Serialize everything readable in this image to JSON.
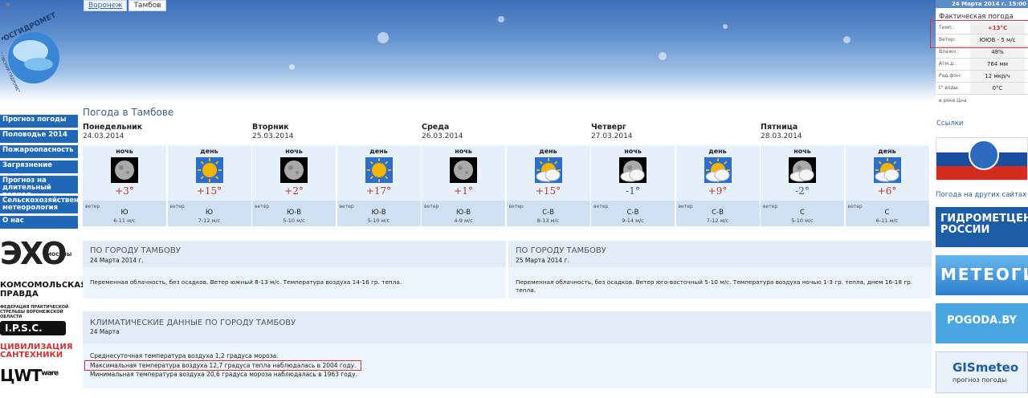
{
  "header": {
    "tabs": [
      {
        "label": "Воронеж"
      },
      {
        "label": "Тамбов"
      }
    ],
    "logo_text": "РОСГИДРОМЕТ",
    "logo_subtext": "ТАМБОВСКИЙ ГИДРОМЕТЦЕНТР",
    "datestamp": "24 Марта 2014 г. 15:00"
  },
  "nav": {
    "items": [
      {
        "label": "Прогноз погоды"
      },
      {
        "label": "Половодье 2014"
      },
      {
        "label": "Пожароопасность"
      },
      {
        "label": "Загрязнение"
      },
      {
        "label": "Прогноз на длительный период"
      },
      {
        "label": "Сельскохозяйственная метеорология"
      },
      {
        "label": "О нас"
      }
    ]
  },
  "left_logos": {
    "echo": "ЭХО",
    "echo_sub": "МОСКВЫ",
    "kp": "КОМСОМОЛЬСКАЯ ПРАВДА",
    "ipsc_caption": "ФЕДЕРАЦИЯ ПРАКТИЧЕСКОЙ СТРЕЛЬБЫ ВОРОНЕЖСКОЙ ОБЛАСТИ",
    "ipsc": "I.P.S.C.",
    "civil": "ЦИВИЛИЗАЦИЯ САНТЕХНИКИ",
    "ware": "ЦWT",
    "ware_sup": "ware"
  },
  "main": {
    "title": "Погода в Тамбове",
    "wind_label": "ветер",
    "days": [
      {
        "name": "Понедельник",
        "date": "24.03.2014",
        "periods": [
          {
            "time": "ночь",
            "icon": "moon-icon",
            "temp": "+3°",
            "wind_dir": "Ю",
            "wind_speed": "6-11 м/с"
          },
          {
            "time": "день",
            "icon": "sun-icon",
            "temp": "+15°",
            "wind_dir": "Ю",
            "wind_speed": "7-12 м/с"
          }
        ]
      },
      {
        "name": "Вторник",
        "date": "25.03.2014",
        "periods": [
          {
            "time": "ночь",
            "icon": "moon-icon",
            "temp": "+2°",
            "wind_dir": "Ю-В",
            "wind_speed": "5-10 м/с"
          },
          {
            "time": "день",
            "icon": "sun-icon",
            "temp": "+17°",
            "wind_dir": "Ю-В",
            "wind_speed": "5-10 м/с"
          }
        ]
      },
      {
        "name": "Среда",
        "date": "26.03.2014",
        "periods": [
          {
            "time": "ночь",
            "icon": "moon-icon",
            "temp": "+1°",
            "wind_dir": "Ю-В",
            "wind_speed": "4-9 м/с"
          },
          {
            "time": "день",
            "icon": "sun-cloud-icon",
            "temp": "+15°",
            "wind_dir": "С-В",
            "wind_speed": "8-13 м/с"
          }
        ]
      },
      {
        "name": "Четверг",
        "date": "27.03.2014",
        "periods": [
          {
            "time": "ночь",
            "icon": "moon-cloud-icon",
            "temp": "-1°",
            "wind_dir": "С-В",
            "wind_speed": "9-14 м/с"
          },
          {
            "time": "день",
            "icon": "sun-cloud-icon",
            "temp": "+9°",
            "wind_dir": "С-В",
            "wind_speed": "7-12 м/с"
          }
        ]
      },
      {
        "name": "Пятница",
        "date": "28.03.2014",
        "periods": [
          {
            "time": "ночь",
            "icon": "moon-cloud-icon",
            "temp": "-2°",
            "wind_dir": "С",
            "wind_speed": "5-10 м/с"
          },
          {
            "time": "день",
            "icon": "sun-cloud-icon",
            "temp": "+6°",
            "wind_dir": "С",
            "wind_speed": "6-11 м/с"
          }
        ]
      }
    ]
  },
  "forecast": [
    {
      "title": "ПО ГОРОДУ ТАМБОВУ",
      "date": "24 Марта 2014 г.",
      "text": "Переменная облачность, без осадков. Ветер южный 8-13 м/с. Температура воздуха 14-16 гр. тепла."
    },
    {
      "title": "ПО ГОРОДУ ТАМБОВУ",
      "date": "25 Марта 2014 г.",
      "text": "Переменная облачность, без осадков. Ветер юго-восточный 5-10 м/с. Температура воздуха ночью 1-3 гр. тепла, днем 16-18 гр. тепла."
    }
  ],
  "climate": {
    "title": "КЛИМАТИЧЕСКИЕ ДАННЫЕ ПО ГОРОДУ ТАМБОВУ",
    "date": "24 Марта",
    "lines": [
      "Среднесуточная температура воздуха 1,2 градуса мороза.",
      "Максимальная температура воздуха 12,7 градуса тепла наблюдалась в 2004 году.",
      "Минимальная температура воздуха 20,6 градуса мороза наблюдалась в 1963 году."
    ]
  },
  "actual_weather": {
    "title": "Фактическая погода",
    "rows": [
      {
        "label": "Темп.:",
        "value": "+13°С"
      },
      {
        "label": "Ветер:",
        "value": "ЮЮВ - 5 м/с"
      },
      {
        "label": "Влажн.:",
        "value": "48%"
      },
      {
        "label": "Атм.д.:",
        "value": "764 мм"
      },
      {
        "label": "Рад.фон:",
        "value": "12 мкр/ч"
      },
      {
        "label": "t° воды:",
        "value": "0°С"
      }
    ],
    "river": "в реке Цна"
  },
  "links": {
    "title": "Ссылки",
    "other_title": "Погода на других сайтах",
    "banners": [
      {
        "text": "ГИДРОМЕТЦЕНТР РОССИИ"
      },
      {
        "text": "МЕТЕОГИД"
      },
      {
        "text": "POGODA.BY"
      },
      {
        "text": "GISmeteo",
        "sub": "прогноз погоды"
      }
    ]
  }
}
